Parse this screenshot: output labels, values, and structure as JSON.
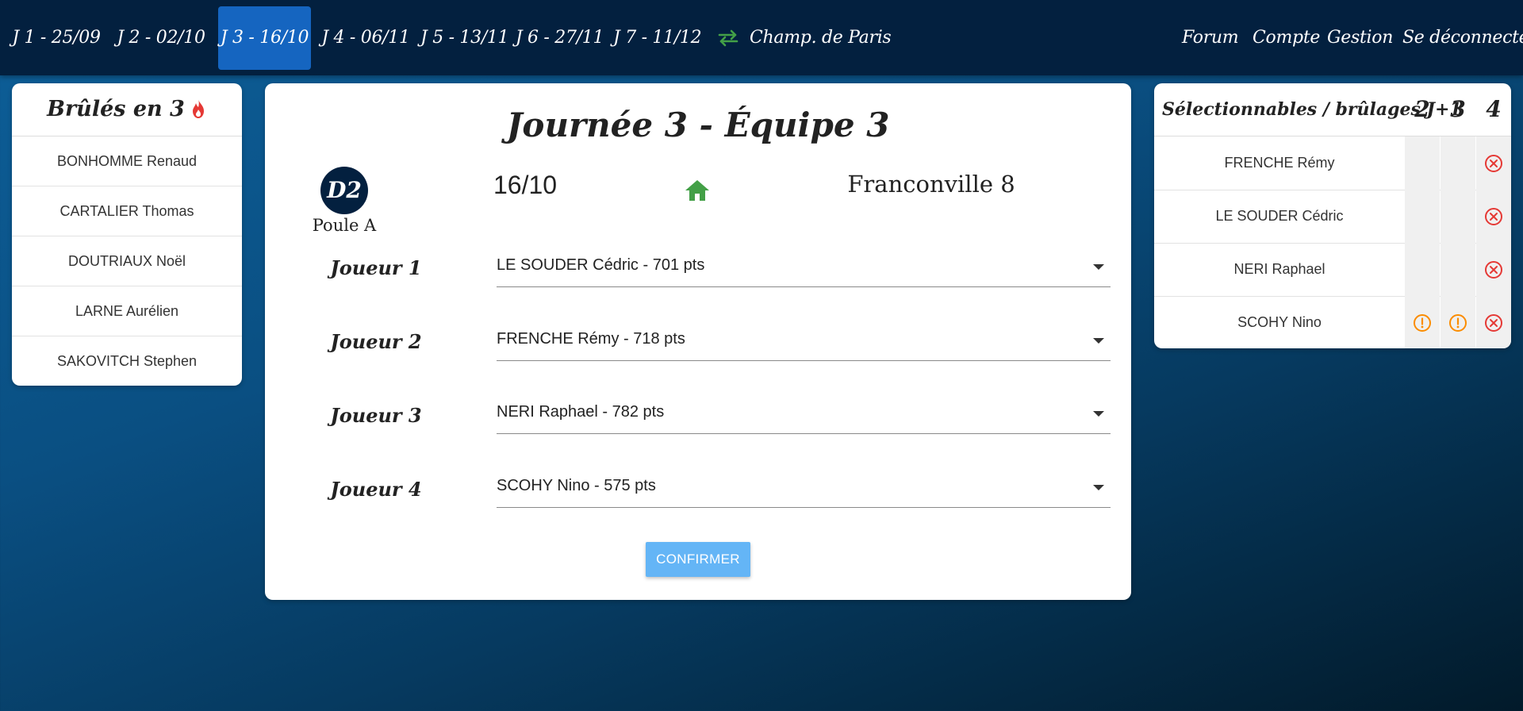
{
  "nav": {
    "days": [
      {
        "label": "J 1 - 25/09",
        "active": false
      },
      {
        "label": "J 2 - 02/10",
        "active": false
      },
      {
        "label": "J 3 - 16/10",
        "active": true
      },
      {
        "label": "J 4 - 06/11",
        "active": false
      },
      {
        "label": "J 5 - 13/11",
        "active": false
      },
      {
        "label": "J 6 - 27/11",
        "active": false
      },
      {
        "label": "J 7 - 11/12",
        "active": false
      }
    ],
    "swap_icon": "swap-arrows-icon",
    "champ_label": "Champ. de Paris",
    "right_links": [
      "Forum",
      "Compte",
      "Gestion",
      "Se déconnecter"
    ],
    "accent_color": "#1565c0",
    "bar_color": "#03203f"
  },
  "burned": {
    "title": "Brûlés en 3",
    "icon": "fire-icon",
    "players": [
      "BONHOMME Renaud",
      "CARTALIER Thomas",
      "DOUTRIAUX Noël",
      "LARNE Aurélien",
      "SAKOVITCH Stephen"
    ]
  },
  "match": {
    "title": "Journée 3 - Équipe 3",
    "division": "D2",
    "poule": "Poule A",
    "date": "16/10",
    "venue_icon": "home-icon",
    "opponent": "Franconville 8",
    "home_color": "#43a047",
    "players": [
      {
        "label": "Joueur 1",
        "value": "LE SOUDER Cédric - 701 pts"
      },
      {
        "label": "Joueur 2",
        "value": "FRENCHE Rémy - 718 pts"
      },
      {
        "label": "Joueur 3",
        "value": "NERI Raphael - 782 pts"
      },
      {
        "label": "Joueur 4",
        "value": "SCOHY Nino - 575 pts"
      }
    ],
    "confirm_label": "CONFIRMER",
    "confirm_color": "#64b5f6"
  },
  "selectable": {
    "title": "Sélectionnables / brûlages J+1",
    "columns": [
      "2",
      "3",
      "4"
    ],
    "rows": [
      {
        "name": "FRENCHE Rémy",
        "cells": [
          "",
          "",
          "close-circle-icon"
        ]
      },
      {
        "name": "LE SOUDER Cédric",
        "cells": [
          "",
          "",
          "close-circle-icon"
        ]
      },
      {
        "name": "NERI Raphael",
        "cells": [
          "",
          "",
          "close-circle-icon"
        ]
      },
      {
        "name": "SCOHY Nino",
        "cells": [
          "alert-circle-icon",
          "alert-circle-icon",
          "close-circle-icon"
        ]
      }
    ],
    "warning_color": "#fb8c00",
    "error_color": "#e53935"
  }
}
